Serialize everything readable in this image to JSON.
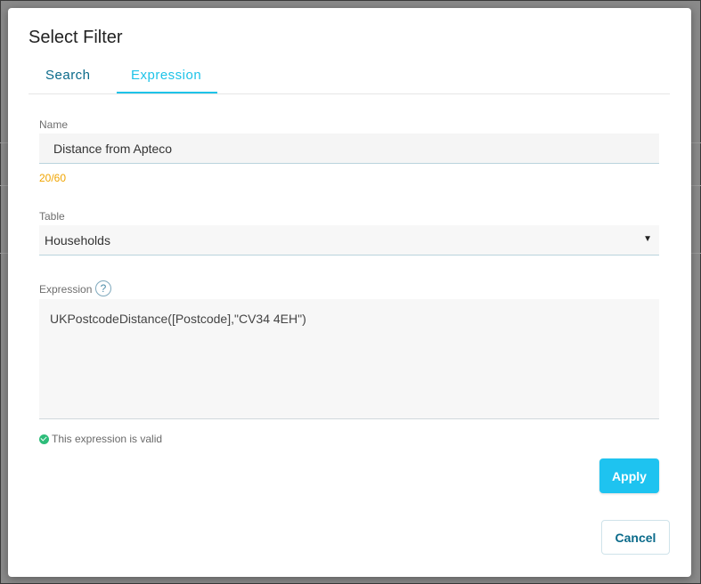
{
  "dialog": {
    "title": "Select Filter"
  },
  "tabs": [
    {
      "label": "Search",
      "active": false
    },
    {
      "label": "Expression",
      "active": true
    }
  ],
  "name_field": {
    "label": "Name",
    "value": "Distance from Apteco",
    "counter": "20/60"
  },
  "table_field": {
    "label": "Table",
    "selected": "Households",
    "caret": "▼"
  },
  "expression_field": {
    "label": "Expression",
    "help": "?",
    "value": "UKPostcodeDistance([Postcode],\"CV34 4EH\")",
    "status": "This expression is valid"
  },
  "buttons": {
    "apply": "Apply",
    "cancel": "Cancel"
  },
  "colors": {
    "accent": "#1ec3f0",
    "tab_active": "#1ec3e8",
    "tab_inactive": "#0a6a8a",
    "counter": "#f0a400",
    "valid": "#2ebd7a"
  },
  "icons": {
    "help": "help-circle-icon",
    "valid": "check-circle-icon",
    "caret": "caret-down-icon"
  }
}
